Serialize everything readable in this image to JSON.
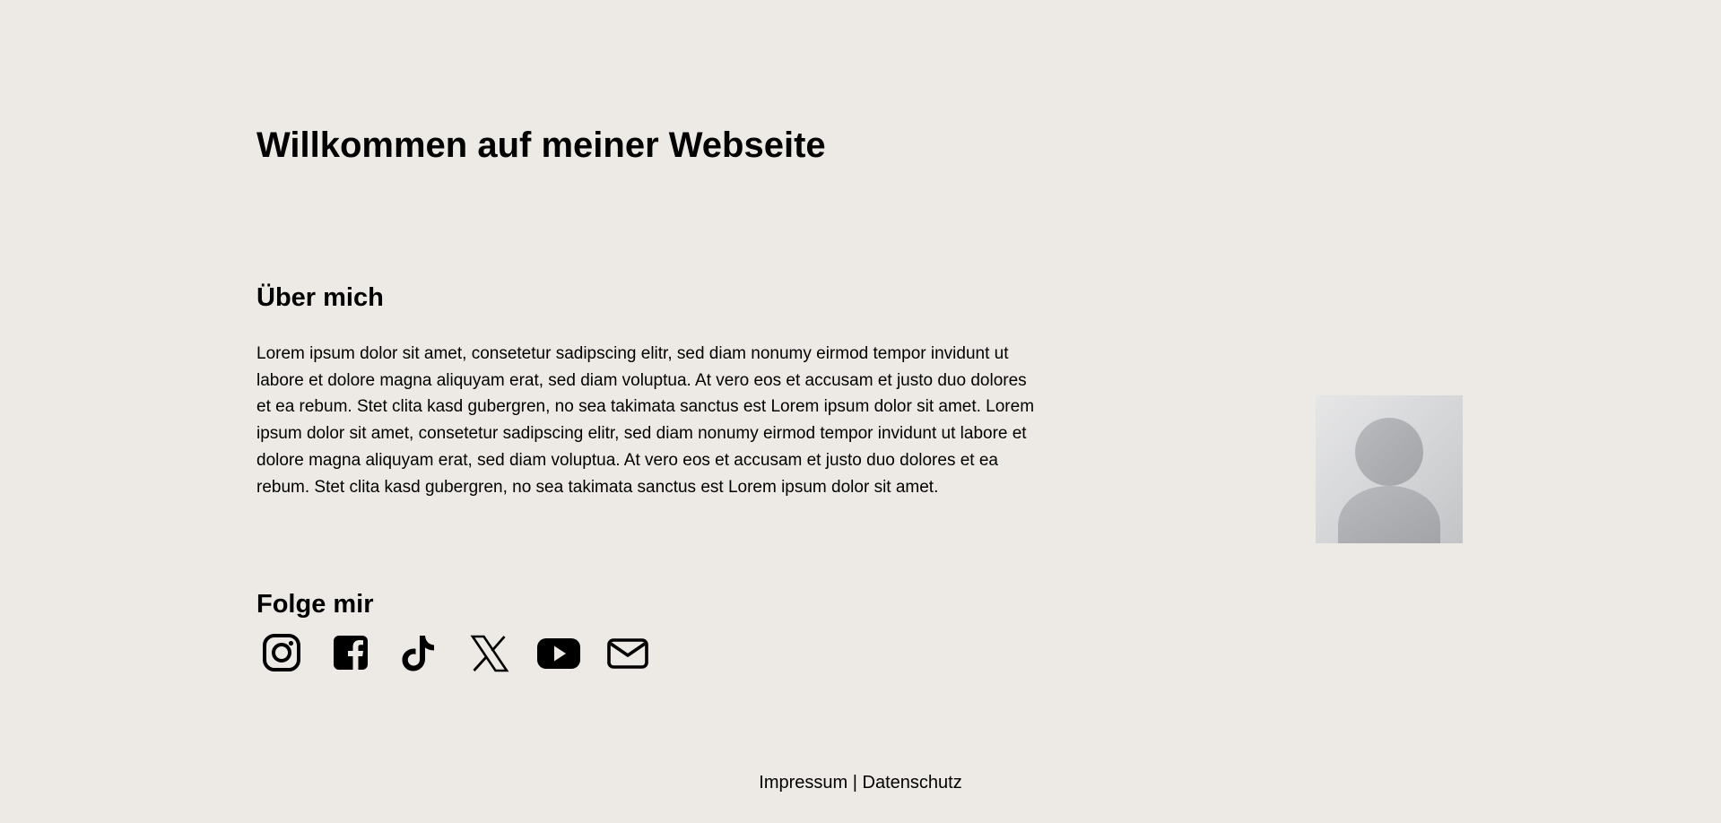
{
  "header": {
    "title": "Willkommen auf meiner Webseite"
  },
  "about": {
    "heading": "Über mich",
    "text": "Lorem ipsum dolor sit amet, consetetur sadipscing elitr, sed diam nonumy eirmod tempor invidunt ut labore et dolore magna aliquyam erat, sed diam voluptua. At vero eos et accusam et justo duo dolores et ea rebum. Stet clita kasd gubergren, no sea takimata sanctus est Lorem ipsum dolor sit amet. Lorem ipsum dolor sit amet, consetetur sadipscing elitr, sed diam nonumy eirmod tempor invidunt ut labore et dolore magna aliquyam erat, sed diam voluptua. At vero eos et accusam et justo duo dolores et ea rebum. Stet clita kasd gubergren, no sea takimata sanctus est Lorem ipsum dolor sit amet.",
    "avatar_icon": "person-placeholder-icon"
  },
  "social": {
    "heading": "Folge mir",
    "icons": [
      "instagram-icon",
      "facebook-icon",
      "tiktok-icon",
      "x-icon",
      "youtube-icon",
      "mail-icon"
    ]
  },
  "footer": {
    "impressum": "Impressum",
    "separator": " | ",
    "datenschutz": "Datenschutz"
  },
  "colors": {
    "background": "#edeae5",
    "text": "#000000",
    "avatar_figure": "#aeafb2"
  }
}
